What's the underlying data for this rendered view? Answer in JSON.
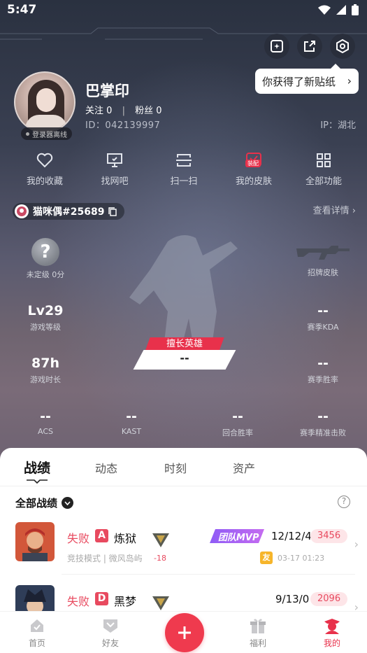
{
  "status_bar": {
    "time": "5:47"
  },
  "tooltip": {
    "text": "你获得了新贴纸"
  },
  "profile": {
    "username": "巴掌印",
    "follow_label": "关注",
    "follow_count": "0",
    "fans_label": "粉丝",
    "fans_count": "0",
    "uid": "ID：042139997",
    "ip": "IP：湖北",
    "login_status": "登录器离线"
  },
  "quick_actions": [
    {
      "label": "我的收藏",
      "icon": "heart-icon"
    },
    {
      "label": "找网吧",
      "icon": "monitor-icon"
    },
    {
      "label": "扫一扫",
      "icon": "scan-icon"
    },
    {
      "label": "我的皮肤",
      "icon": "skin-icon",
      "badge": "装配"
    },
    {
      "label": "全部功能",
      "icon": "grid-icon"
    }
  ],
  "game_tag": {
    "name": "猫咪偶#25689"
  },
  "detail_link": "查看详情",
  "stats": {
    "rank": {
      "value": "?",
      "label": "未定级 0分"
    },
    "skin": {
      "label": "招牌皮肤"
    },
    "level": {
      "value": "Lv29",
      "label": "游戏等级"
    },
    "kda": {
      "value": "--",
      "label": "赛季KDA"
    },
    "playtime": {
      "value": "87h",
      "label": "游戏时长"
    },
    "winrate": {
      "value": "--",
      "label": "赛季胜率"
    },
    "acs": {
      "value": "--",
      "label": "ACS"
    },
    "kast": {
      "value": "--",
      "label": "KAST"
    },
    "round_win": {
      "value": "--",
      "label": "回合胜率"
    },
    "headshot": {
      "value": "--",
      "label": "赛季精准击败"
    }
  },
  "hero": {
    "tag": "擅长英雄",
    "value": "--"
  },
  "tabs": [
    "战绩",
    "动态",
    "时刻",
    "资产"
  ],
  "section": {
    "title": "全部战绩"
  },
  "matches": [
    {
      "result": "失败",
      "grade": "A",
      "map": "炼狱",
      "mode": "竞技模式 | 微风岛屿",
      "delta": "-18",
      "mvp": "团队MVP",
      "kda": "12/12/4",
      "score": "3456",
      "friend": "友",
      "time": "03-17 01:23"
    },
    {
      "result": "失败",
      "grade": "D",
      "map": "黑梦",
      "kda": "9/13/0",
      "score": "2096"
    }
  ],
  "nav": [
    {
      "label": "首页",
      "icon": "home-icon"
    },
    {
      "label": "好友",
      "icon": "friends-icon"
    },
    {
      "label": "福利",
      "icon": "gift-icon"
    },
    {
      "label": "我的",
      "icon": "profile-icon"
    }
  ],
  "colors": {
    "accent": "#e8314b",
    "sheet_bg": "#ffffff"
  }
}
